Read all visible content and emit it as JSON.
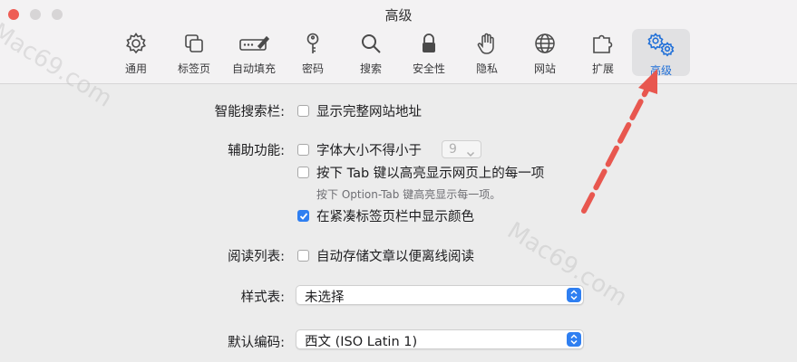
{
  "window": {
    "title": "高级"
  },
  "toolbar": {
    "tabs": [
      {
        "label": "通用",
        "icon": "gear-icon"
      },
      {
        "label": "标签页",
        "icon": "tabs-icon"
      },
      {
        "label": "自动填充",
        "icon": "pencil-field-icon"
      },
      {
        "label": "密码",
        "icon": "key-icon"
      },
      {
        "label": "搜索",
        "icon": "magnifier-icon"
      },
      {
        "label": "安全性",
        "icon": "lock-icon"
      },
      {
        "label": "隐私",
        "icon": "hand-icon"
      },
      {
        "label": "网站",
        "icon": "globe-icon"
      },
      {
        "label": "扩展",
        "icon": "puzzle-icon"
      },
      {
        "label": "高级",
        "icon": "gears-icon",
        "active": true
      }
    ]
  },
  "smart_search": {
    "label": "智能搜索栏:",
    "option": "显示完整网站地址",
    "checked": false
  },
  "accessibility": {
    "label": "辅助功能:",
    "font_option": "字体大小不得小于",
    "font_value": "9",
    "tab_option": "按下 Tab 键以高亮显示网页上的每一项",
    "tab_hint": "按下 Option-Tab 键高亮显示每一项。",
    "color_option": "在紧凑标签页栏中显示颜色",
    "color_checked": true
  },
  "reading_list": {
    "label": "阅读列表:",
    "option": "自动存储文章以便离线阅读",
    "checked": false
  },
  "stylesheet": {
    "label": "样式表:",
    "value": "未选择"
  },
  "encoding": {
    "label": "默认编码:",
    "value": "西文 (ISO Latin 1)"
  },
  "watermark": {
    "text": "Mac69.com"
  },
  "colors": {
    "accent": "#2f7ff1",
    "arrow": "#e8574f"
  }
}
